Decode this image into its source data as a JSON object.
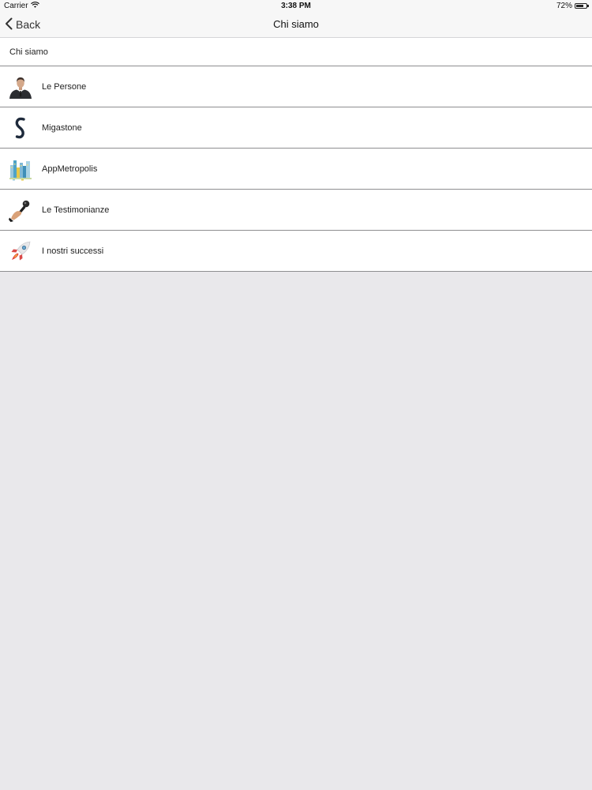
{
  "status_bar": {
    "carrier": "Carrier",
    "time": "3:38 PM",
    "battery_percent": "72%",
    "battery_level": 0.72,
    "icons": [
      "wifi-icon",
      "battery-icon"
    ]
  },
  "nav": {
    "back_label": "Back",
    "title": "Chi siamo",
    "back_icon": "chevron-left-icon"
  },
  "section": {
    "header": "Chi siamo"
  },
  "items": [
    {
      "label": "Le Persone",
      "icon": "businessman-icon"
    },
    {
      "label": "Migastone",
      "icon": "migastone-logo-icon"
    },
    {
      "label": "AppMetropolis",
      "icon": "city-skyline-icon"
    },
    {
      "label": "Le Testimonianze",
      "icon": "microphone-hand-icon"
    },
    {
      "label": "I nostri successi",
      "icon": "rocket-icon"
    }
  ],
  "colors": {
    "background": "#e9e8eb",
    "bar": "#f7f7f7",
    "list_background": "#ffffff",
    "separator": "#8e8e90"
  }
}
